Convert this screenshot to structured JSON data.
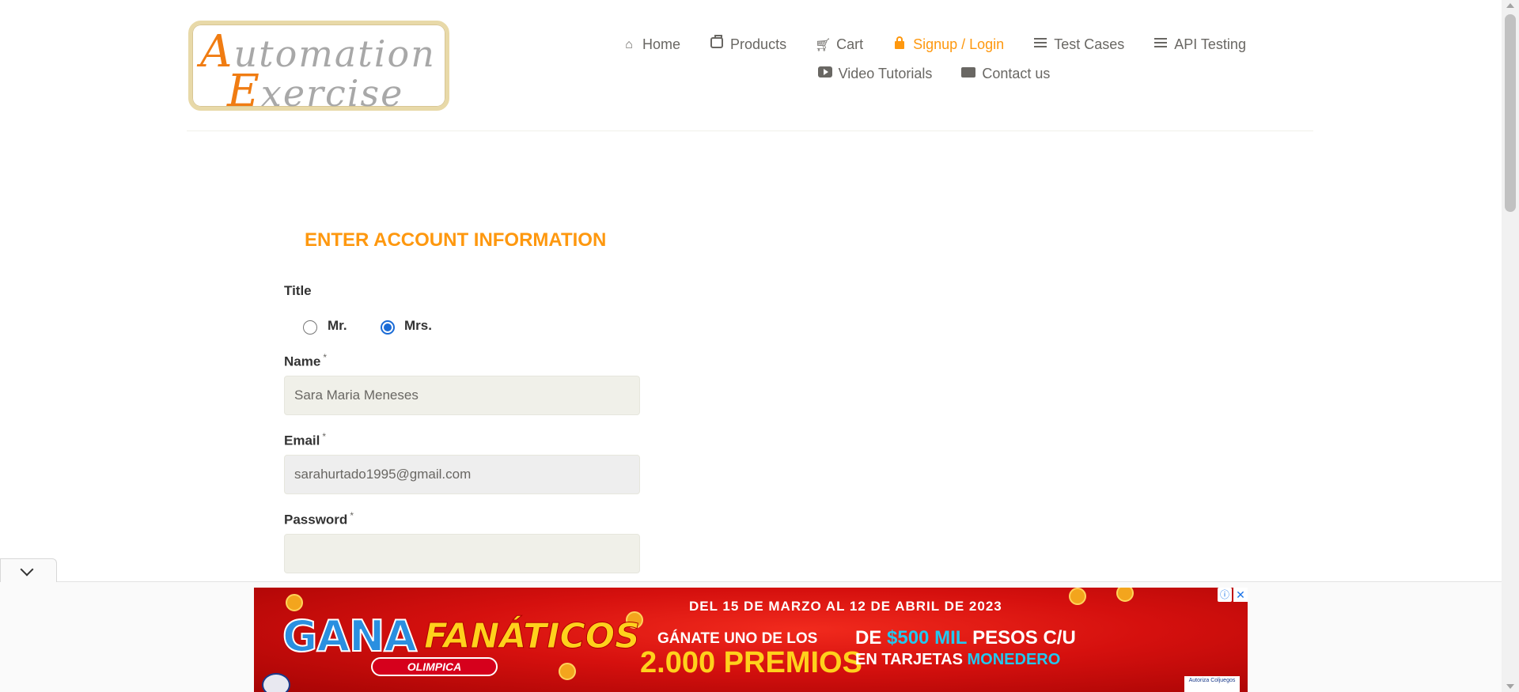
{
  "logo": {
    "line1_cap": "A",
    "line1_rest": "utomation",
    "line2_cap": "E",
    "line2_rest": "xercise"
  },
  "nav": {
    "row1": [
      {
        "label": "Home",
        "icon": "home-icon"
      },
      {
        "label": "Products",
        "icon": "briefcase-icon"
      },
      {
        "label": "Cart",
        "icon": "cart-icon"
      },
      {
        "label": "Signup / Login",
        "icon": "lock-icon",
        "active": true
      },
      {
        "label": "Test Cases",
        "icon": "list-icon"
      },
      {
        "label": "API Testing",
        "icon": "list-icon"
      }
    ],
    "row2": [
      {
        "label": "Video Tutorials",
        "icon": "youtube-play-icon"
      },
      {
        "label": "Contact us",
        "icon": "envelope-icon"
      }
    ]
  },
  "form": {
    "title": "ENTER ACCOUNT INFORMATION",
    "title_label": "Title",
    "radio_mr": "Mr.",
    "radio_mrs": "Mrs.",
    "selected_title": "Mrs.",
    "name_label": "Name",
    "name_value": "Sara Maria Meneses",
    "email_label": "Email",
    "email_value": "sarahurtado1995@gmail.com",
    "password_label": "Password",
    "password_value": "",
    "required_mark": "*"
  },
  "ad": {
    "dates": "DEL 15 DE MARZO AL 12 DE ABRIL DE 2023",
    "gana": "GANA",
    "fanaticos": "FANÁTICOS",
    "olimpica": "OLIMPICA",
    "win_line1": "GÁNATE UNO DE LOS",
    "win_line2": "2.000 PREMIOS",
    "prize_line1_a": "DE ",
    "prize_line1_b": "$500 MIL",
    "prize_line1_c": " PESOS C/U",
    "prize_line2_a": "EN TARJETAS ",
    "prize_line2_b": "MONEDERO",
    "info_glyph": "ⓘ",
    "close_glyph": "✕",
    "badge_text": "Autoriza Coljuegos"
  },
  "colors": {
    "accent": "#fe980f",
    "text": "#696763",
    "field_bg": "#f0f0e9",
    "radio_selected": "#1a6bd6",
    "ad_red": "#d5100e"
  }
}
